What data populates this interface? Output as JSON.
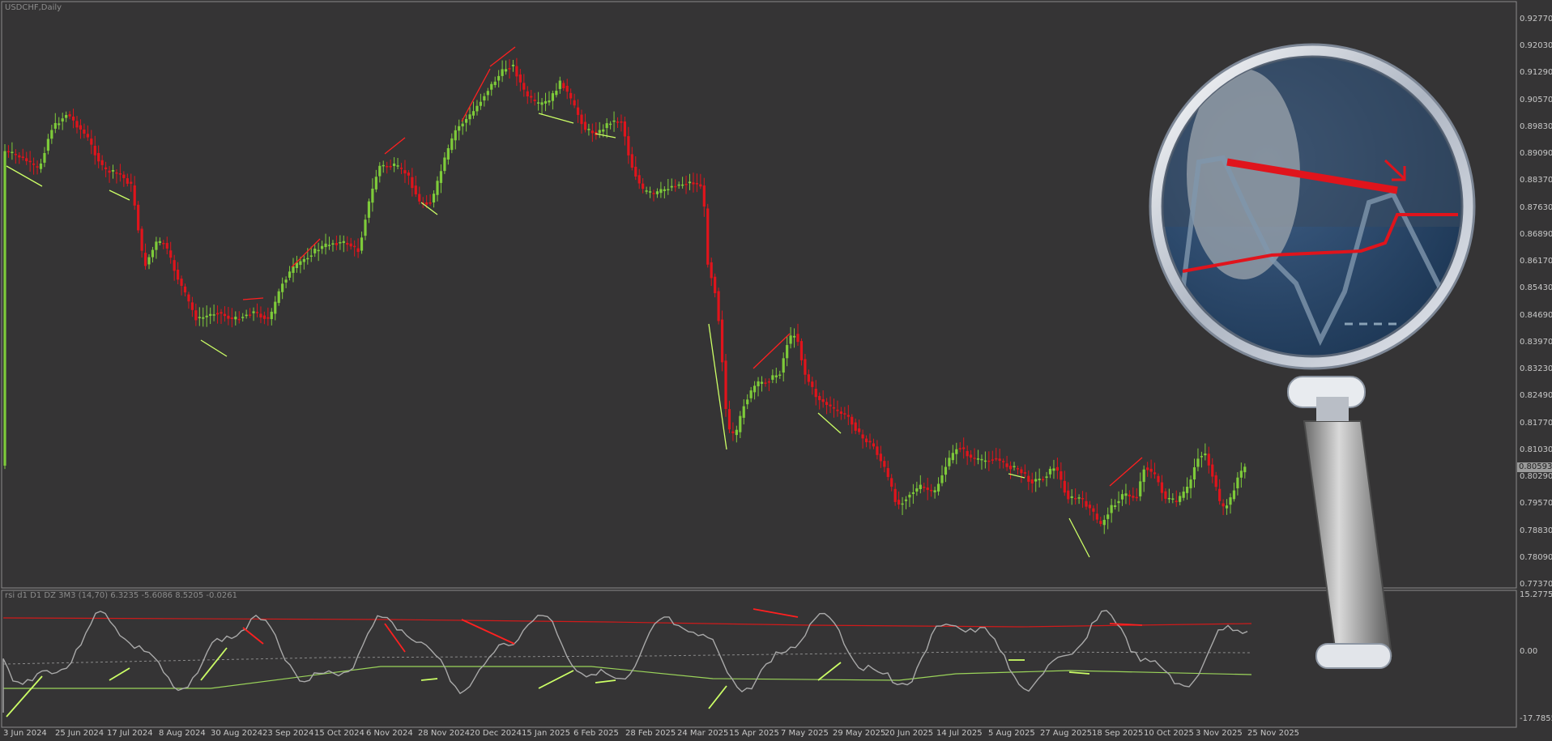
{
  "window": {
    "title": "USDCHF,Daily"
  },
  "indicator": {
    "label": "rsi d1 D1 DZ 3M3 (14,70) 6.3235 -5.6086 8.5205 -0.0261"
  },
  "price_axis": {
    "ticks": [
      "0.92770",
      "0.92030",
      "0.91290",
      "0.90570",
      "0.89830",
      "0.89090",
      "0.88370",
      "0.87630",
      "0.86890",
      "0.86170",
      "0.85430",
      "0.84690",
      "0.83970",
      "0.83230",
      "0.82490",
      "0.81770",
      "0.81030",
      "0.80290",
      "0.79570",
      "0.78830",
      "0.78090",
      "0.77370"
    ],
    "current_price": "0.80593"
  },
  "indicator_axis": {
    "ticks": [
      "15.2775",
      "0.00",
      "-17.7855"
    ]
  },
  "date_axis": {
    "ticks": [
      "3 Jun 2024",
      "25 Jun 2024",
      "17 Jul 2024",
      "8 Aug 2024",
      "30 Aug 2024",
      "23 Sep 2024",
      "15 Oct 2024",
      "6 Nov 2024",
      "28 Nov 2024",
      "20 Dec 2024",
      "15 Jan 2025",
      "6 Feb 2025",
      "28 Feb 2025",
      "24 Mar 2025",
      "15 Apr 2025",
      "7 May 2025",
      "29 May 2025",
      "20 Jun 2025",
      "14 Jul 2025",
      "5 Aug 2025",
      "27 Aug 2025",
      "18 Sep 2025",
      "10 Oct 2025",
      "3 Nov 2025",
      "25 Nov 2025"
    ]
  },
  "colors": {
    "background": "#353435",
    "bull_candle": "#7ecb3a",
    "bear_candle": "#e0141c",
    "rsi_line": "#a9a9a9",
    "upper_band": "#d11a1a",
    "lower_band": "#9bd45a",
    "bull_divergence": "#ccff66",
    "bear_divergence": "#ff2020"
  },
  "overlay": {
    "magnifier_icon": "magnifying-glass-icon"
  }
}
